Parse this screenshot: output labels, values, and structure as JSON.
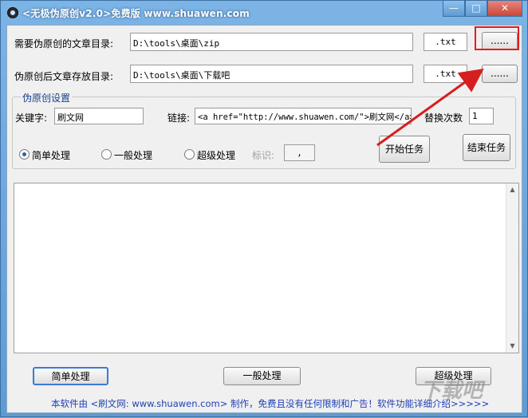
{
  "window": {
    "title": "<无极伪原创v2.0>免费版 www.shuawen.com",
    "controls": {
      "minimize": "—",
      "maximize": "□",
      "close": "✕"
    }
  },
  "paths": {
    "source_label": "需要伪原创的文章目录:",
    "source_value": "D:\\tools\\桌面\\zip",
    "source_ext": ".txt",
    "source_browse": "......",
    "output_label": "伪原创后文章存放目录:",
    "output_value": "D:\\tools\\桌面\\下载吧",
    "output_ext": ".txt",
    "output_browse": "......"
  },
  "settings": {
    "group_title": "伪原创设置",
    "keyword_label": "关键字:",
    "keyword_value": "刷文网",
    "link_label": "链接:",
    "link_value": "<a href=\"http://www.shuawen.com/\">刷文网</a>",
    "replace_label": "替换次数",
    "replace_value": "1",
    "modes": [
      {
        "label": "简单处理",
        "checked": true
      },
      {
        "label": "一般处理",
        "checked": false
      },
      {
        "label": "超级处理",
        "checked": false
      }
    ],
    "marker_label": "标识:",
    "marker_value": ",",
    "start_button": "开始任务",
    "stop_button": "结束任务"
  },
  "bottom_buttons": {
    "simple": "简单处理",
    "normal": "一般处理",
    "super": "超级处理"
  },
  "footer": "本软件由 <刷文网: www.shuawen.com> 制作，免费且没有任何限制和广告！软件功能详细介绍>>>>>",
  "watermark": "下载吧",
  "colors": {
    "highlight": "#e01e1e",
    "footer_link": "#1f3fb5",
    "titlebar": "#6fa7d8"
  }
}
